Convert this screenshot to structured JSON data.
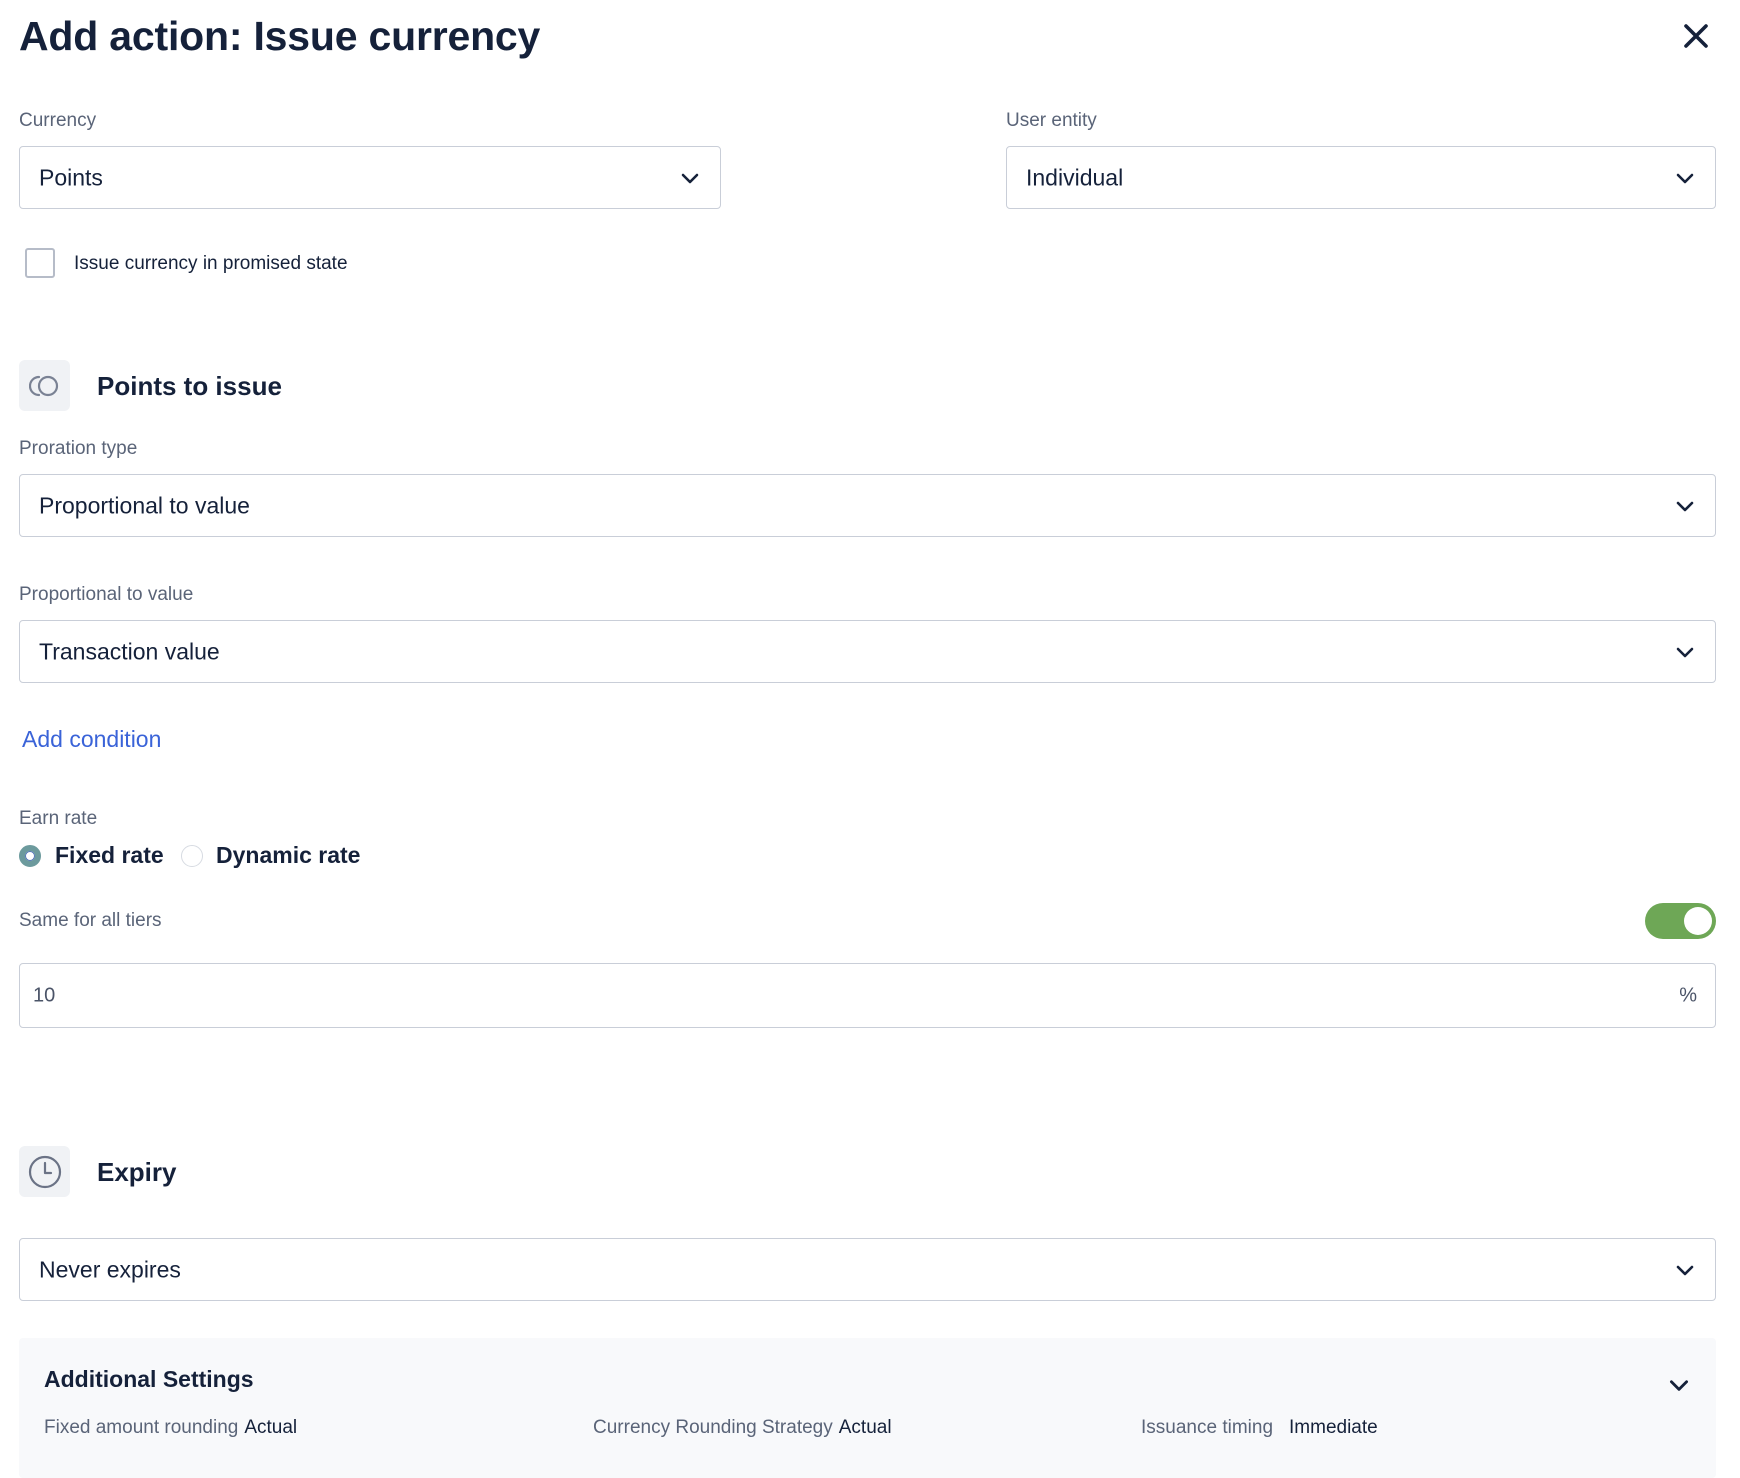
{
  "header": {
    "title": "Add action: Issue currency",
    "close_icon": "close-icon"
  },
  "currency": {
    "label": "Currency",
    "value": "Points"
  },
  "user_entity": {
    "label": "User entity",
    "value": "Individual"
  },
  "promised_state": {
    "label": "Issue currency in promised state",
    "checked": false
  },
  "points_section": {
    "title": "Points to issue",
    "icon": "coins-icon",
    "proration_type": {
      "label": "Proration type",
      "value": "Proportional to value"
    },
    "proportional_to": {
      "label": "Proportional to value",
      "value": "Transaction value"
    },
    "add_condition_label": "Add condition",
    "earn_rate": {
      "label": "Earn rate",
      "options": [
        {
          "label": "Fixed rate",
          "selected": true
        },
        {
          "label": "Dynamic rate",
          "selected": false
        }
      ]
    },
    "same_for_all_tiers": {
      "label": "Same for all tiers",
      "enabled": true
    },
    "rate_input": {
      "value": "10",
      "suffix": "%"
    }
  },
  "expiry_section": {
    "title": "Expiry",
    "icon": "clock-icon",
    "value": "Never expires"
  },
  "additional_settings": {
    "title": "Additional Settings",
    "items": [
      {
        "key": "Fixed amount rounding",
        "value": "Actual"
      },
      {
        "key": "Currency Rounding Strategy",
        "value": "Actual"
      },
      {
        "key": "Issuance timing",
        "value": "Immediate"
      }
    ]
  },
  "colors": {
    "text_primary": "#15213a",
    "text_secondary": "#5a6478",
    "link": "#3a63d8",
    "toggle_on": "#6ea756",
    "border": "#c9ced8"
  }
}
